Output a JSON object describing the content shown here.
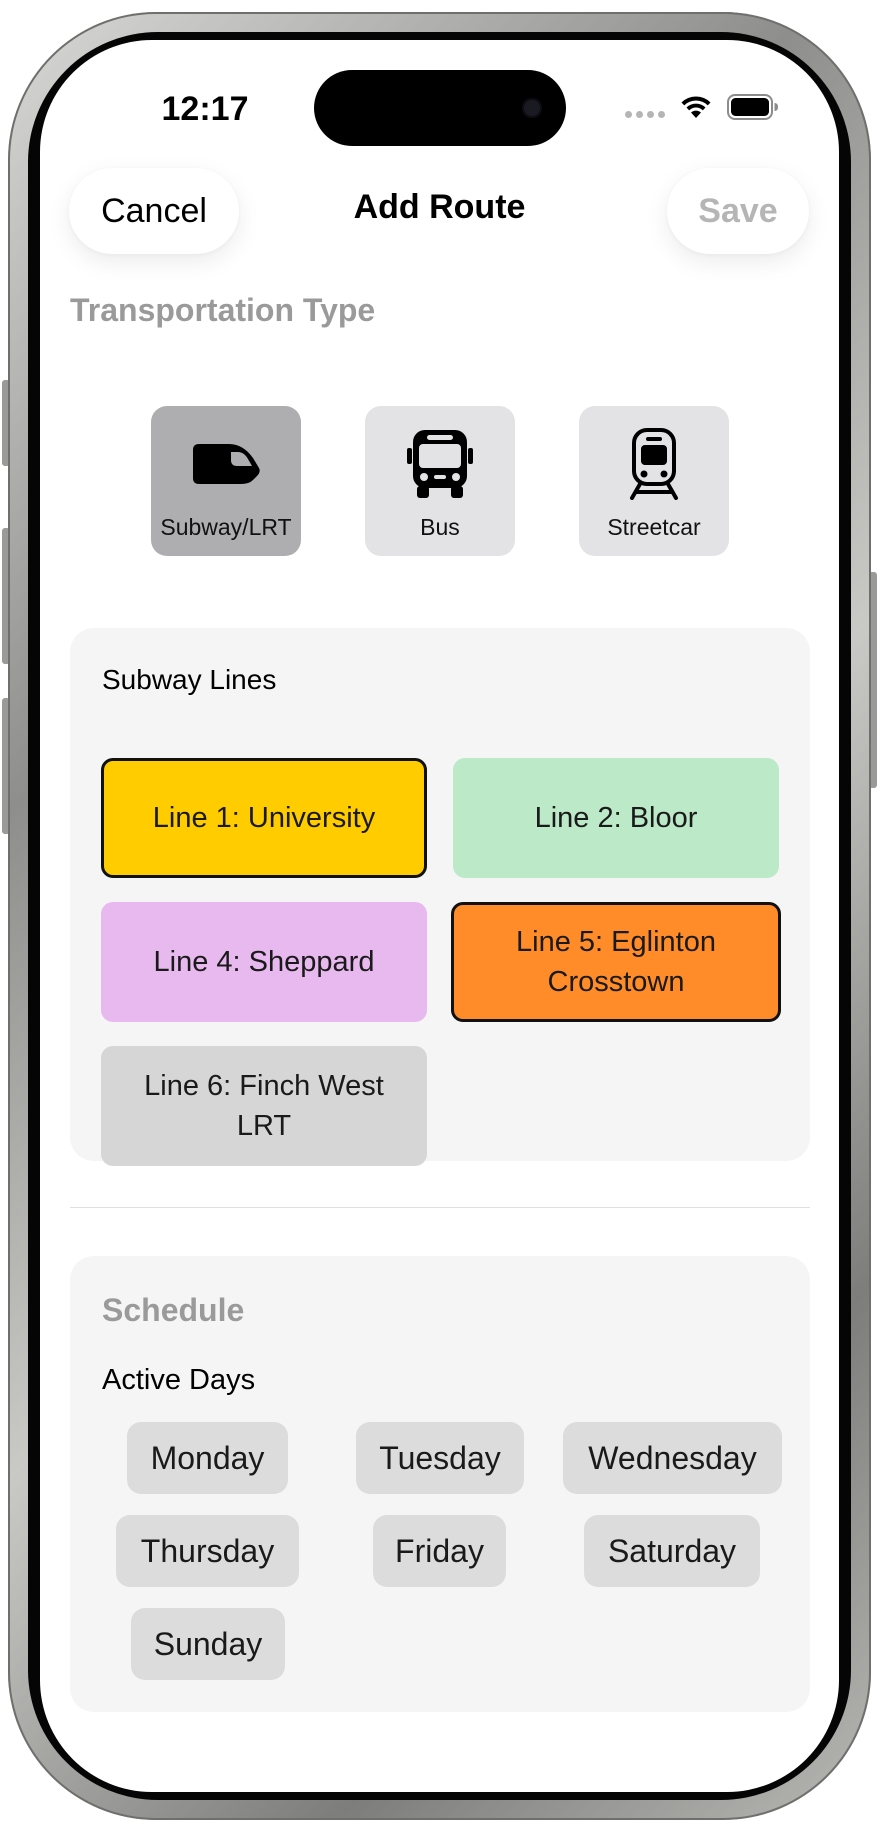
{
  "status_bar": {
    "time": "12:17"
  },
  "nav": {
    "cancel_label": "Cancel",
    "title": "Add Route",
    "save_label": "Save"
  },
  "transport": {
    "section_label": "Transportation Type",
    "types": [
      {
        "label": "Subway/LRT",
        "icon": "subway-icon",
        "selected": true
      },
      {
        "label": "Bus",
        "icon": "bus-icon",
        "selected": false
      },
      {
        "label": "Streetcar",
        "icon": "streetcar-icon",
        "selected": false
      }
    ]
  },
  "subway_lines": {
    "heading": "Subway Lines",
    "lines": [
      {
        "label": "Line 1: University",
        "color": "#FFCC00",
        "selected": true
      },
      {
        "label": "Line 2: Bloor",
        "color": "#BCE9C8",
        "selected": false
      },
      {
        "label": "Line 4: Sheppard",
        "color": "#E7B9EE",
        "selected": false
      },
      {
        "label": "Line 5: Eglinton Crosstown",
        "color": "#FF8C29",
        "selected": true
      },
      {
        "label": "Line 6: Finch West LRT",
        "color": "#D6D6D6",
        "selected": false
      }
    ]
  },
  "schedule": {
    "title": "Schedule",
    "active_days_label": "Active Days",
    "days": [
      "Monday",
      "Tuesday",
      "Wednesday",
      "Thursday",
      "Friday",
      "Saturday",
      "Sunday"
    ]
  },
  "colors": {
    "selected_type_tile": "#AEAEB0",
    "unselected_type_tile": "#E3E3E5",
    "card_background": "#F5F5F5",
    "day_chip": "#DCDCDC",
    "muted_text": "#9A9A9A"
  }
}
